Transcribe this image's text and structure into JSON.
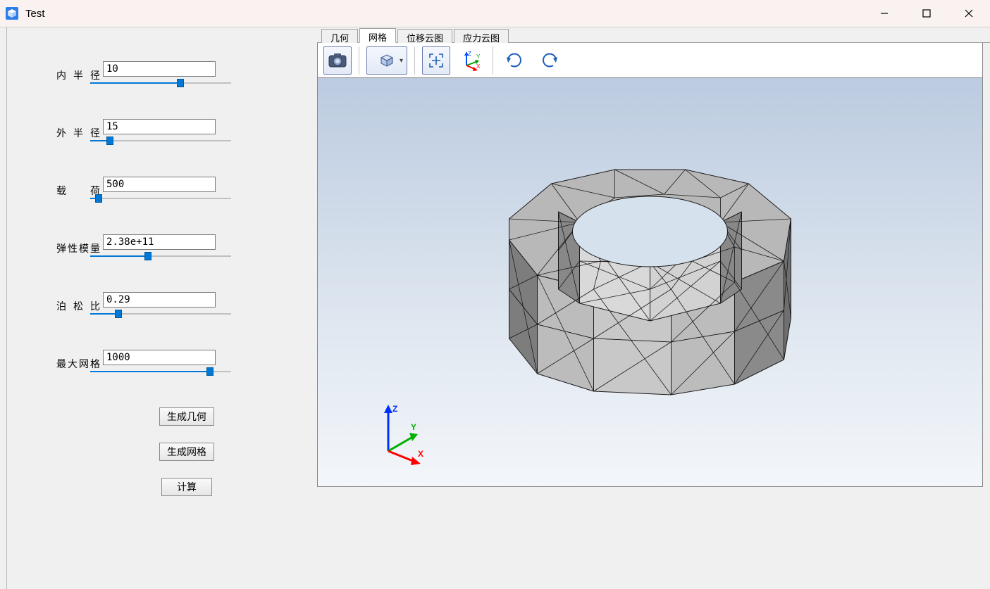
{
  "window": {
    "title": "Test"
  },
  "tabs": [
    {
      "label": "几何",
      "active": false
    },
    {
      "label": "网格",
      "active": true
    },
    {
      "label": "位移云图",
      "active": false
    },
    {
      "label": "应力云图",
      "active": false
    }
  ],
  "params": {
    "inner_radius": {
      "label": "内半径",
      "value": "10",
      "slider_pct": 64
    },
    "outer_radius": {
      "label": "外半径",
      "value": "15",
      "slider_pct": 14
    },
    "load": {
      "label": "载荷",
      "value": "500",
      "slider_pct": 6
    },
    "emodulus": {
      "label": "弹性模量",
      "value": "2.38e+11",
      "slider_pct": 41
    },
    "poisson": {
      "label": "泊松比",
      "value": "0.29",
      "slider_pct": 20
    },
    "max_mesh": {
      "label": "最大网格",
      "value": "1000",
      "slider_pct": 85
    }
  },
  "buttons": {
    "gen_geom": "生成几何",
    "gen_mesh": "生成网格",
    "compute": "计算"
  },
  "toolbar": {
    "screenshot": "screenshot-icon",
    "view_cube": "cube-view-icon",
    "fit": "fit-view-icon",
    "axes": "axes-icon",
    "rotate_cw": "rotate-cw-icon",
    "rotate_ccw": "rotate-ccw-icon"
  },
  "triad": {
    "x": "X",
    "y": "Y",
    "z": "Z"
  }
}
